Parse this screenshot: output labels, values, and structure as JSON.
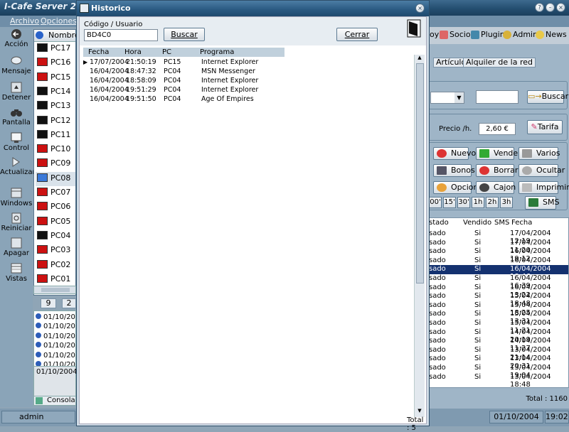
{
  "main": {
    "title": "I-Cafe Server 2004",
    "menu": [
      "Archivo",
      "Opciones"
    ],
    "toolbar": [
      "Acción",
      "Mensaje",
      "Detener",
      "Pantalla",
      "Control",
      "Actualizar",
      "Windows",
      "Reiniciar",
      "Apagar",
      "Vistas"
    ],
    "pc_list_header": "Nombre",
    "pcs": [
      {
        "name": "PC17",
        "color": "#111111"
      },
      {
        "name": "PC16",
        "color": "#cc1111"
      },
      {
        "name": "PC15",
        "color": "#cc1111"
      },
      {
        "name": "PC14",
        "color": "#111111"
      },
      {
        "name": "PC13",
        "color": "#111111"
      },
      {
        "name": "PC12",
        "color": "#111111"
      },
      {
        "name": "PC11",
        "color": "#111111"
      },
      {
        "name": "PC10",
        "color": "#cc1111"
      },
      {
        "name": "PC09",
        "color": "#cc1111"
      },
      {
        "name": "PC08",
        "color": "#3a79d8"
      },
      {
        "name": "PC07",
        "color": "#cc1111"
      },
      {
        "name": "PC06",
        "color": "#cc1111"
      },
      {
        "name": "PC05",
        "color": "#cc1111"
      },
      {
        "name": "PC04",
        "color": "#111111"
      },
      {
        "name": "PC03",
        "color": "#cc1111"
      },
      {
        "name": "PC02",
        "color": "#cc1111"
      },
      {
        "name": "PC01",
        "color": "#cc1111"
      }
    ],
    "small_tabs": [
      "9",
      "2"
    ],
    "log_dates": [
      "01/10/20",
      "01/10/20",
      "01/10/20",
      "01/10/20",
      "01/10/20",
      "01/10/20"
    ],
    "date_box": "01/10/2004",
    "console_tab": "Consola",
    "status_user": "admin",
    "status_date": "01/10/2004",
    "status_time": "19:02"
  },
  "right": {
    "tabs": [
      "oy",
      "Socios",
      "Plugins",
      "Admin",
      "News"
    ],
    "subtabs": [
      "Artículos",
      "Alquiler de la red"
    ],
    "search_label": "Buscar",
    "price_label": "Precio /h.",
    "price_value": "2,60 €",
    "tarifa_label": "Tarifa",
    "buttons": [
      "Nuevo",
      "Vender",
      "Varios",
      "Bonos",
      "Borrar",
      "Ocultar",
      "Opcion",
      "Cajon",
      "Imprimir"
    ],
    "times": [
      "00'",
      "15'",
      "30'",
      "1h",
      "2h",
      "3h"
    ],
    "sms_label": "SMS",
    "table_headers": [
      "stado",
      "Vendido",
      "SMS",
      "Fecha"
    ],
    "rows": [
      {
        "estado": "sado",
        "vendido": "Si",
        "fecha": "17/04/2004 12:19"
      },
      {
        "estado": "sado",
        "vendido": "Si",
        "fecha": "17/04/2004 11:20"
      },
      {
        "estado": "sado",
        "vendido": "Si",
        "fecha": "16/04/2004 19:12"
      },
      {
        "estado": "sado",
        "vendido": "Si",
        "fecha": "16/04/2004 18:53"
      },
      {
        "estado": "sado",
        "vendido": "Si",
        "fecha": "16/04/2004 18:46"
      },
      {
        "estado": "sado",
        "vendido": "Si",
        "fecha": "16/04/2004 16:39"
      },
      {
        "estado": "sado",
        "vendido": "Si",
        "fecha": "16/04/2004 13:22"
      },
      {
        "estado": "sado",
        "vendido": "Si",
        "fecha": "15/04/2004 18:48"
      },
      {
        "estado": "sado",
        "vendido": "Si",
        "fecha": "15/04/2004 18:25"
      },
      {
        "estado": "sado",
        "vendido": "Si",
        "fecha": "15/04/2004 13:31"
      },
      {
        "estado": "sado",
        "vendido": "Si",
        "fecha": "15/04/2004 11:21"
      },
      {
        "estado": "sado",
        "vendido": "Si",
        "fecha": "14/04/2004 20:19"
      },
      {
        "estado": "sado",
        "vendido": "Si",
        "fecha": "14/04/2004 11:27"
      },
      {
        "estado": "sado",
        "vendido": "Si",
        "fecha": "13/04/2004 21:14"
      },
      {
        "estado": "sado",
        "vendido": "Si",
        "fecha": "13/04/2004 20:31"
      },
      {
        "estado": "sado",
        "vendido": "Si",
        "fecha": "13/04/2004 19:04"
      },
      {
        "estado": "sado",
        "vendido": "Si",
        "fecha": "13/04/2004 18:48"
      }
    ],
    "selected_row": 4,
    "total": "Total : 1160"
  },
  "historico": {
    "title": "Historico",
    "code_label": "Código / Usuario",
    "code_value": "BD4C0",
    "search_button": "Buscar",
    "close_button": "Cerrar",
    "headers": [
      "Fecha",
      "Hora",
      "PC",
      "Programa"
    ],
    "rows": [
      {
        "fecha": "17/07/2004",
        "hora": "21:50:19",
        "pc": "PC15",
        "programa": "Internet Explorer"
      },
      {
        "fecha": "16/04/2004",
        "hora": "18:47:32",
        "pc": "PC04",
        "programa": "MSN Messenger"
      },
      {
        "fecha": "16/04/2004",
        "hora": "18:58:09",
        "pc": "PC04",
        "programa": "Internet Explorer"
      },
      {
        "fecha": "16/04/2004",
        "hora": "19:51:29",
        "pc": "PC04",
        "programa": "Internet Explorer"
      },
      {
        "fecha": "16/04/2004",
        "hora": "19:51:50",
        "pc": "PC04",
        "programa": "Age Of Empires"
      }
    ],
    "total": "Total : 5"
  }
}
